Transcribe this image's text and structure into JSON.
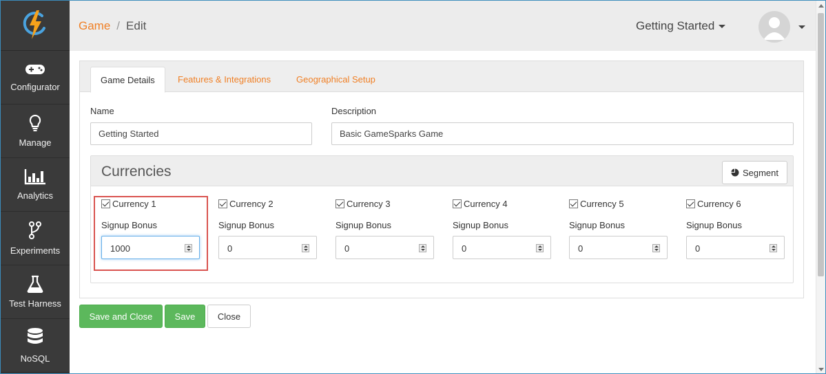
{
  "breadcrumb": {
    "parent": "Game",
    "separator": "/",
    "current": "Edit"
  },
  "header": {
    "game_selector": "Getting Started"
  },
  "sidebar": {
    "items": [
      {
        "label": "Configurator",
        "icon": "gamepad-icon"
      },
      {
        "label": "Manage",
        "icon": "lightbulb-icon"
      },
      {
        "label": "Analytics",
        "icon": "bar-chart-icon"
      },
      {
        "label": "Experiments",
        "icon": "branch-icon"
      },
      {
        "label": "Test Harness",
        "icon": "flask-icon"
      },
      {
        "label": "NoSQL",
        "icon": "database-icon"
      }
    ]
  },
  "tabs": [
    {
      "label": "Game Details",
      "active": true
    },
    {
      "label": "Features & Integrations",
      "active": false
    },
    {
      "label": "Geographical Setup",
      "active": false
    }
  ],
  "form": {
    "name_label": "Name",
    "name_value": "Getting Started",
    "description_label": "Description",
    "description_value": "Basic GameSparks Game"
  },
  "currencies": {
    "title": "Currencies",
    "segment_label": "Segment",
    "bonus_label": "Signup Bonus",
    "items": [
      {
        "label": "Currency 1",
        "checked": true,
        "value": "1000"
      },
      {
        "label": "Currency 2",
        "checked": true,
        "value": "0"
      },
      {
        "label": "Currency 3",
        "checked": true,
        "value": "0"
      },
      {
        "label": "Currency 4",
        "checked": true,
        "value": "0"
      },
      {
        "label": "Currency 5",
        "checked": true,
        "value": "0"
      },
      {
        "label": "Currency 6",
        "checked": true,
        "value": "0"
      }
    ]
  },
  "buttons": {
    "save_close": "Save and Close",
    "save": "Save",
    "close": "Close"
  },
  "colors": {
    "accent": "#f07f24",
    "sidebar": "#3a3a3a",
    "success": "#5cb85c",
    "highlight": "#d9534f"
  }
}
